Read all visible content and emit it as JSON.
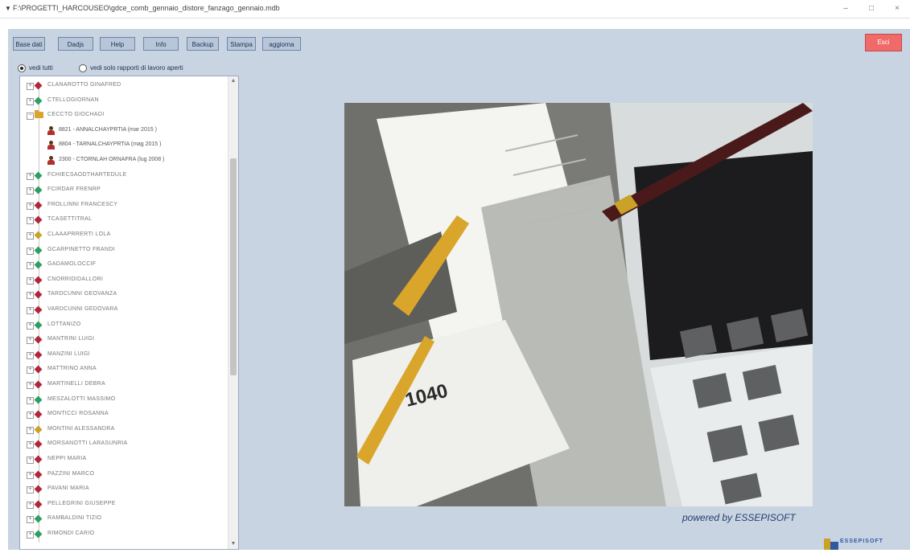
{
  "window": {
    "title": "F:\\PROGETTI_HARCOUSEO\\gdce_comb_gennaio_distore_fanzago_gennaio.mdb",
    "minimize_label": "–",
    "maximize_label": "□",
    "close_label": "×"
  },
  "toolbar": {
    "buttons": [
      "Base dati",
      "Dadjs",
      "Help",
      "Info",
      "Backup",
      "Stampa",
      "aggiorna"
    ],
    "exit_label": "Esci"
  },
  "filter": {
    "options": [
      "vedi tutti",
      "vedi solo rapporti di lavoro aperti"
    ],
    "selected": "vedi tutti"
  },
  "tree": {
    "items": [
      {
        "name": "CLANAROTTO GINAFRED",
        "status": "red",
        "expanded": false
      },
      {
        "name": "CTELLOGIORNAN",
        "status": "green",
        "expanded": false
      },
      {
        "name": "CECCTO GIOCHADI",
        "status": "folder",
        "expanded": true
      },
      {
        "name": "8821 - ANNALCHAYPRTIA  (mar 2015 )",
        "status": "person",
        "child": true
      },
      {
        "name": "8804 - TARNALCHAYPRTIA  (mag 2015 )",
        "status": "person",
        "child": true
      },
      {
        "name": "2300 - CTORNLAH ORNAFRA (lug 2008 )",
        "status": "person",
        "child": true
      },
      {
        "name": "FCHIECSAODTHARTEDULE",
        "status": "green",
        "expanded": false
      },
      {
        "name": "FCIRDAR FRENRP",
        "status": "green",
        "expanded": false
      },
      {
        "name": "FROLLINNI FRANCESCY",
        "status": "red",
        "expanded": false
      },
      {
        "name": "TCASETTITRAL",
        "status": "red",
        "expanded": false
      },
      {
        "name": "CLAAAPRRERTI LOLA",
        "status": "yellow",
        "expanded": false
      },
      {
        "name": "GCARPINETTO FRANDI",
        "status": "green",
        "expanded": false
      },
      {
        "name": "GADAMOLOCCIF",
        "status": "green",
        "expanded": false
      },
      {
        "name": "CNORRIDIDALLORI",
        "status": "red",
        "expanded": false
      },
      {
        "name": "TARDCUNNI GEOVANZA",
        "status": "red",
        "expanded": false
      },
      {
        "name": "VARDCUNNI GEDOVARA",
        "status": "red",
        "expanded": false
      },
      {
        "name": "LOTTANIZO",
        "status": "green",
        "expanded": false
      },
      {
        "name": "MANTRINI LUIGI",
        "status": "red",
        "expanded": false
      },
      {
        "name": "MANZINI LUIGI",
        "status": "red",
        "expanded": false
      },
      {
        "name": "MATTRINO ANNA",
        "status": "red",
        "expanded": false
      },
      {
        "name": "MARTINELLI DEBRA",
        "status": "red",
        "expanded": false
      },
      {
        "name": "MESZALOTTI MASSIMO",
        "status": "green",
        "expanded": false
      },
      {
        "name": "MONTICCI ROSANNA",
        "status": "red",
        "expanded": false
      },
      {
        "name": "MONTINI ALESSANDRA",
        "status": "yellow",
        "expanded": false
      },
      {
        "name": "MORSANOTTI LARASUNRIA",
        "status": "red",
        "expanded": false
      },
      {
        "name": "NEPPI MARIA",
        "status": "red",
        "expanded": false
      },
      {
        "name": "PAZZINI MARCO",
        "status": "red",
        "expanded": false
      },
      {
        "name": "PAVANI MARIA",
        "status": "red",
        "expanded": false
      },
      {
        "name": "PELLEGRINI GIUSEPPE",
        "status": "red",
        "expanded": false
      },
      {
        "name": "RAMBALDINI TIZIO",
        "status": "green",
        "expanded": false
      },
      {
        "name": "RIMONDI CARIO",
        "status": "green",
        "expanded": false
      }
    ]
  },
  "branding": {
    "powered_by": "powered by ESSEPISOFT",
    "logo_text": "ESSEPISOFT"
  },
  "colors": {
    "client_bg": "#c9d4e3",
    "exit_button": "#f06a6a",
    "status_red": "#b3263a",
    "status_green": "#2d9f63",
    "status_yellow": "#c9a227"
  }
}
